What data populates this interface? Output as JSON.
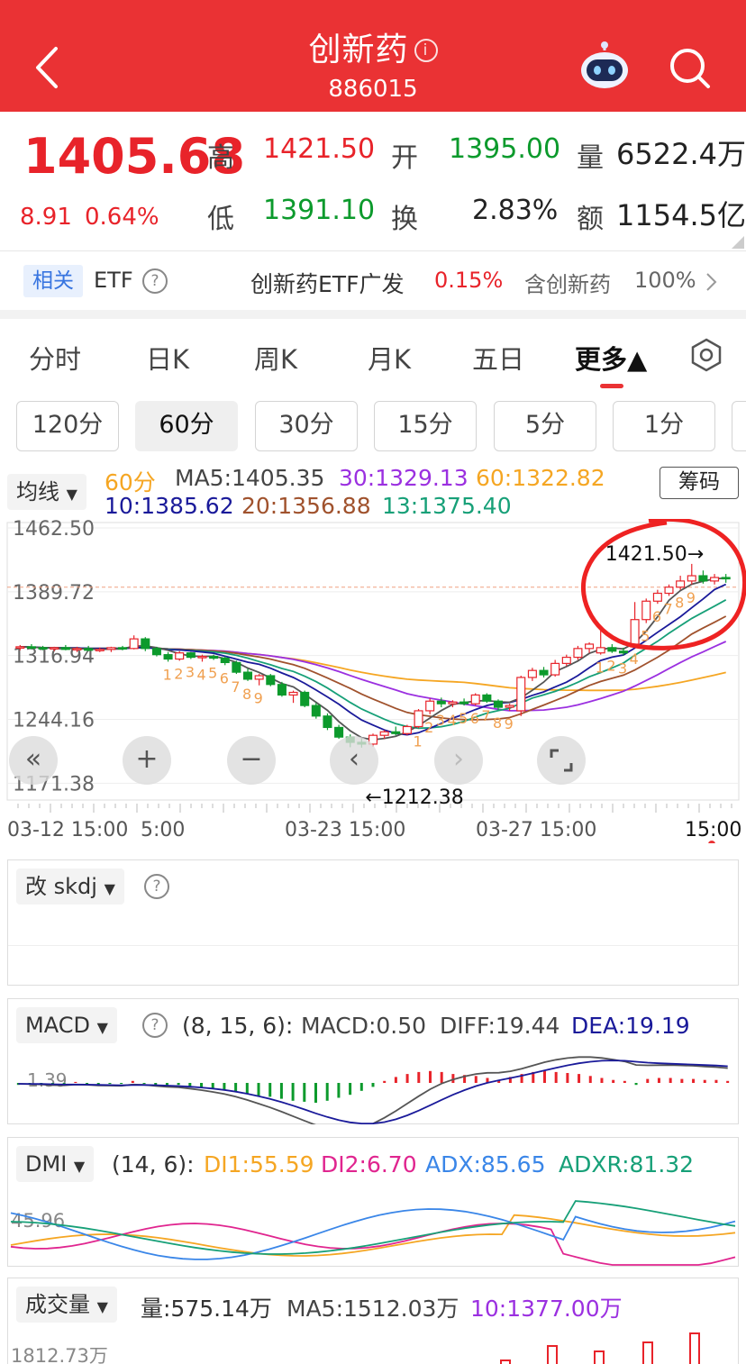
{
  "header": {
    "title": "创新药",
    "code": "886015",
    "back_icon": "chevron-left-icon",
    "robot_icon": "robot-icon",
    "search_icon": "search-icon"
  },
  "quote": {
    "price": "1405.68",
    "change": "8.91",
    "change_pct": "0.64%",
    "high_label": "高",
    "high": "1421.50",
    "open_label": "开",
    "open": "1395.00",
    "vol_label": "量",
    "vol": "6522.4万",
    "low_label": "低",
    "low": "1391.10",
    "turnover_label": "换",
    "turnover": "2.83%",
    "amount_label": "额",
    "amount": "1154.5亿"
  },
  "etf": {
    "tag": "相关",
    "etf_label": "ETF",
    "fund": "创新药ETF广发",
    "fund_pct": "0.15%",
    "contain": "含创新药",
    "contain_pct": "100%"
  },
  "tabs": [
    "分时",
    "日K",
    "周K",
    "月K",
    "五日",
    "更多▲"
  ],
  "periods": [
    "120分",
    "60分",
    "30分",
    "15分",
    "5分",
    "1分"
  ],
  "ma": {
    "dropdown": "均线",
    "chip_btn": "筹码",
    "p60": "60分",
    "ma5": "MA5:1405.35",
    "ma30": "30:1329.13",
    "ma60": "60:1322.82",
    "ma10": "10:1385.62",
    "ma20": "20:1356.88",
    "ma13": "13:1375.40"
  },
  "colors": {
    "up": "#e8232a",
    "down": "#0c9a2c",
    "ma5": "#555555",
    "ma10": "#1a1a9a",
    "ma20": "#a0522d",
    "ma13": "#17a078",
    "ma30": "#9b30e0",
    "ma60": "#f5a623"
  },
  "chart_data": [
    {
      "type": "candlestick",
      "y_ticks": [
        "1462.50",
        "1389.72",
        "1316.94",
        "1244.16",
        "1171.38"
      ],
      "ylim": [
        1171.38,
        1462.5
      ],
      "x_ticks": [
        "03-12 15:00",
        "5:00",
        "03-23 15:00",
        "03-27 15:00",
        "15:00"
      ],
      "max_label": "1421.50→",
      "min_label": "←1212.38",
      "candles": [
        [
          1326,
          1329,
          1323,
          1327
        ],
        [
          1327,
          1330,
          1324,
          1326
        ],
        [
          1326,
          1328,
          1323,
          1325
        ],
        [
          1325,
          1327,
          1322,
          1326
        ],
        [
          1326,
          1329,
          1323,
          1324
        ],
        [
          1324,
          1327,
          1321,
          1325
        ],
        [
          1325,
          1328,
          1322,
          1323
        ],
        [
          1323,
          1326,
          1321,
          1324
        ],
        [
          1324,
          1327,
          1321,
          1326
        ],
        [
          1326,
          1328,
          1323,
          1325
        ],
        [
          1325,
          1340,
          1324,
          1336
        ],
        [
          1336,
          1338,
          1322,
          1325
        ],
        [
          1325,
          1327,
          1316,
          1318
        ],
        [
          1318,
          1321,
          1310,
          1313
        ],
        [
          1313,
          1322,
          1311,
          1320
        ],
        [
          1320,
          1321,
          1313,
          1315
        ],
        [
          1315,
          1318,
          1310,
          1316
        ],
        [
          1316,
          1318,
          1312,
          1314
        ],
        [
          1314,
          1316,
          1306,
          1309
        ],
        [
          1309,
          1311,
          1296,
          1298
        ],
        [
          1298,
          1302,
          1288,
          1290
        ],
        [
          1290,
          1296,
          1283,
          1294
        ],
        [
          1294,
          1296,
          1282,
          1284
        ],
        [
          1284,
          1287,
          1270,
          1272
        ],
        [
          1272,
          1277,
          1263,
          1275
        ],
        [
          1275,
          1277,
          1258,
          1260
        ],
        [
          1260,
          1263,
          1245,
          1248
        ],
        [
          1248,
          1251,
          1232,
          1235
        ],
        [
          1235,
          1238,
          1222,
          1224
        ],
        [
          1224,
          1227,
          1212.38,
          1218
        ],
        [
          1218,
          1222,
          1212,
          1216
        ],
        [
          1216,
          1228,
          1213,
          1226
        ],
        [
          1226,
          1232,
          1222,
          1230
        ],
        [
          1230,
          1236,
          1226,
          1228
        ],
        [
          1228,
          1238,
          1226,
          1236
        ],
        [
          1236,
          1256,
          1234,
          1254
        ],
        [
          1254,
          1268,
          1250,
          1265
        ],
        [
          1265,
          1269,
          1258,
          1262
        ],
        [
          1262,
          1266,
          1258,
          1264
        ],
        [
          1264,
          1268,
          1260,
          1262
        ],
        [
          1262,
          1274,
          1260,
          1272
        ],
        [
          1272,
          1274,
          1263,
          1265
        ],
        [
          1265,
          1267,
          1255,
          1258
        ],
        [
          1258,
          1262,
          1254,
          1260
        ],
        [
          1254,
          1294,
          1248,
          1292
        ],
        [
          1292,
          1303,
          1288,
          1300
        ],
        [
          1300,
          1304,
          1292,
          1295
        ],
        [
          1295,
          1312,
          1293,
          1308
        ],
        [
          1308,
          1318,
          1305,
          1315
        ],
        [
          1315,
          1328,
          1312,
          1325
        ],
        [
          1325,
          1332,
          1320,
          1330
        ],
        [
          1320,
          1348,
          1318,
          1326
        ],
        [
          1326,
          1330,
          1320,
          1322
        ],
        [
          1322,
          1326,
          1317,
          1320
        ],
        [
          1330,
          1378,
          1328,
          1358
        ],
        [
          1358,
          1382,
          1354,
          1379
        ],
        [
          1379,
          1392,
          1376,
          1388
        ],
        [
          1388,
          1398,
          1385,
          1395
        ],
        [
          1395,
          1408,
          1392,
          1402
        ],
        [
          1402,
          1421.5,
          1398,
          1408
        ],
        [
          1408,
          1414,
          1399,
          1402
        ],
        [
          1402,
          1410,
          1398,
          1406
        ],
        [
          1406,
          1410,
          1400,
          1405.68
        ]
      ],
      "sequence_top": [
        "1",
        "2",
        "3",
        "4",
        "5",
        "6",
        "7",
        "8",
        "9"
      ]
    },
    {
      "type": "line",
      "name": "skdj",
      "dropdown": "改 skdj"
    },
    {
      "type": "bar+line",
      "dropdown": "MACD",
      "params": "(8, 15, 6):",
      "macd": "MACD:0.50",
      "diff": "DIFF:19.44",
      "dea": "DEA:19.19",
      "y_tick": "1.39",
      "hist": [
        -2,
        -1,
        -1,
        -2,
        -1,
        1,
        -1,
        -2,
        -1,
        -1,
        2,
        -1,
        -3,
        -3,
        -2,
        -4,
        -5,
        -6,
        -7,
        -9,
        -11,
        -13,
        -14,
        -16,
        -18,
        -19,
        -20,
        -18,
        -15,
        -12,
        -8,
        -4,
        2,
        6,
        9,
        11,
        12,
        11,
        9,
        8,
        7,
        5,
        3,
        6,
        9,
        11,
        12,
        11,
        10,
        9,
        7,
        5,
        3,
        2,
        -2,
        4,
        5,
        5,
        4,
        4,
        3,
        3,
        2
      ]
    },
    {
      "type": "line",
      "dropdown": "DMI",
      "params": "(14, 6):",
      "di1": "DI1:55.59",
      "di2": "DI2:6.70",
      "adx": "ADX:85.65",
      "adxr": "ADXR:81.32",
      "y_tick": "45.96"
    },
    {
      "type": "bar",
      "dropdown": "成交量",
      "vol": "量:575.14万",
      "ma5": "MA5:1512.03万",
      "ma10": "10:1377.00万",
      "y_tick": "1812.73万"
    }
  ]
}
